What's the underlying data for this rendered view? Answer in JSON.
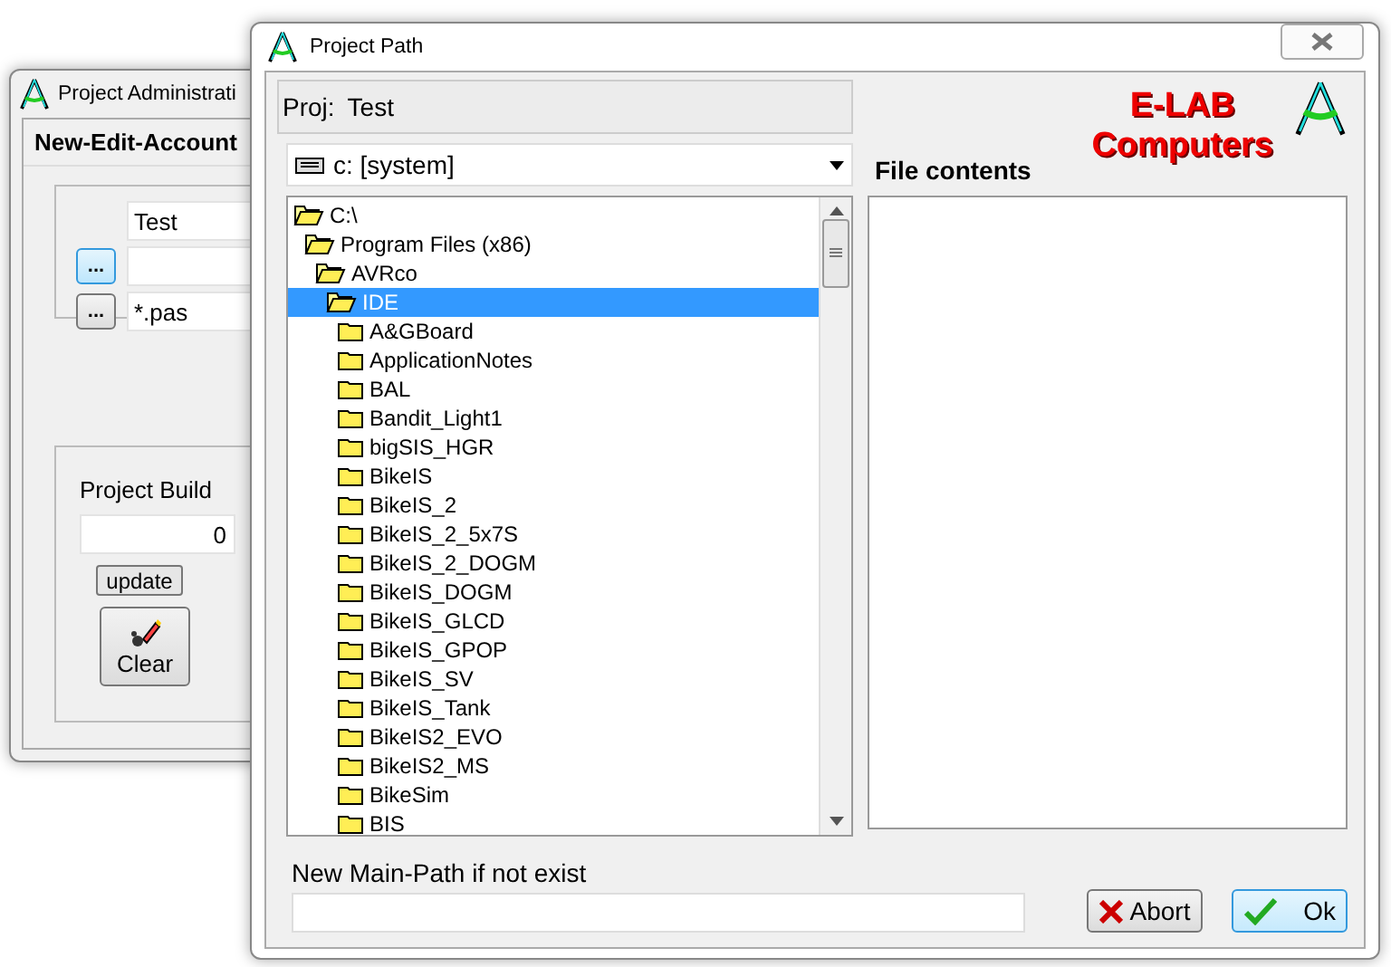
{
  "back_window": {
    "title": "Project Administrati",
    "panel_title": "New-Edit-Account",
    "fields": [
      {
        "kind": "text",
        "value": "Test"
      },
      {
        "kind": "browse",
        "button": "...",
        "focused": true
      },
      {
        "kind": "browse",
        "button": "...",
        "focused": false,
        "value": "*.pas"
      }
    ],
    "build": {
      "label": "Project Build",
      "value": "0",
      "update_button": "update",
      "clear_button": "Clear"
    }
  },
  "front_window": {
    "title": "Project Path",
    "proj_label": "Proj:",
    "proj_name": "Test",
    "drive": "c: [system]",
    "tree": [
      {
        "name": "C:\\",
        "open": true,
        "selected": false,
        "children": [
          {
            "name": "Program Files (x86)",
            "open": true,
            "selected": false,
            "children": [
              {
                "name": "AVRco",
                "open": true,
                "selected": false,
                "children": [
                  {
                    "name": "IDE",
                    "open": true,
                    "selected": true,
                    "children": [
                      {
                        "name": "A&GBoard",
                        "open": false,
                        "selected": false
                      },
                      {
                        "name": "ApplicationNotes",
                        "open": false,
                        "selected": false
                      },
                      {
                        "name": "BAL",
                        "open": false,
                        "selected": false
                      },
                      {
                        "name": "Bandit_Light1",
                        "open": false,
                        "selected": false
                      },
                      {
                        "name": "bigSIS_HGR",
                        "open": false,
                        "selected": false
                      },
                      {
                        "name": "BikeIS",
                        "open": false,
                        "selected": false
                      },
                      {
                        "name": "BikeIS_2",
                        "open": false,
                        "selected": false
                      },
                      {
                        "name": "BikeIS_2_5x7S",
                        "open": false,
                        "selected": false
                      },
                      {
                        "name": "BikeIS_2_DOGM",
                        "open": false,
                        "selected": false
                      },
                      {
                        "name": "BikeIS_DOGM",
                        "open": false,
                        "selected": false
                      },
                      {
                        "name": "BikeIS_GLCD",
                        "open": false,
                        "selected": false
                      },
                      {
                        "name": "BikeIS_GPOP",
                        "open": false,
                        "selected": false
                      },
                      {
                        "name": "BikeIS_SV",
                        "open": false,
                        "selected": false
                      },
                      {
                        "name": "BikeIS_Tank",
                        "open": false,
                        "selected": false
                      },
                      {
                        "name": "BikeIS2_EVO",
                        "open": false,
                        "selected": false
                      },
                      {
                        "name": "BikeIS2_MS",
                        "open": false,
                        "selected": false
                      },
                      {
                        "name": "BikeSim",
                        "open": false,
                        "selected": false
                      },
                      {
                        "name": "BIS",
                        "open": false,
                        "selected": false
                      }
                    ]
                  }
                ]
              }
            ]
          }
        ]
      }
    ],
    "file_contents_label": "File contents",
    "brand": [
      "E-LAB",
      "Computers"
    ],
    "new_path_label": "New Main-Path  if not exist",
    "buttons": [
      {
        "kind": "abort",
        "label": "Abort",
        "default": false
      },
      {
        "kind": "ok",
        "label": "Ok",
        "default": true
      }
    ]
  }
}
